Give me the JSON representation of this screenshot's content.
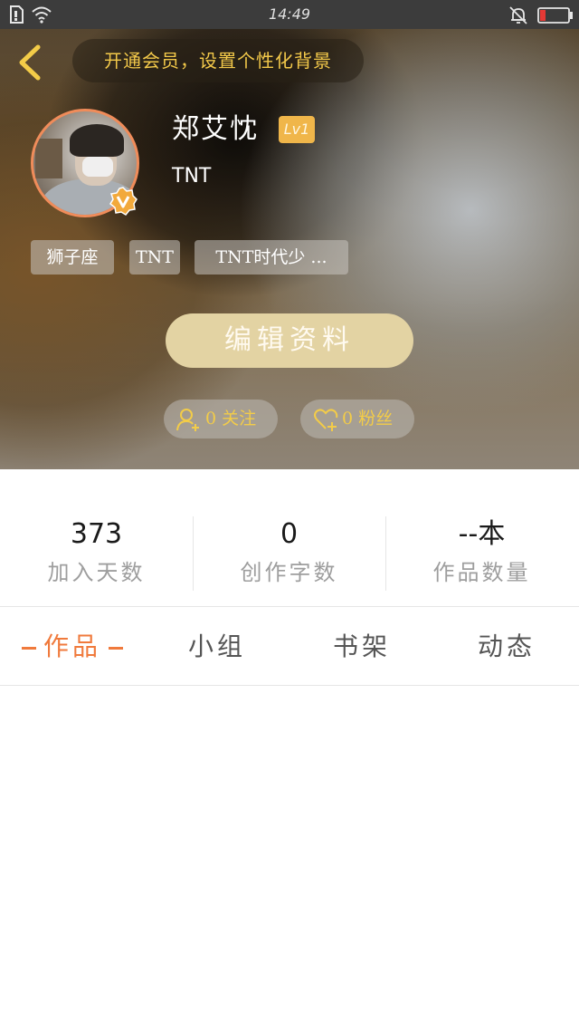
{
  "status_bar": {
    "time": "14:49",
    "icons": [
      "sim-icon",
      "wifi-icon",
      "mute-bell-icon",
      "battery-icon"
    ]
  },
  "header": {
    "vip_banner": "开通会员，设置个性化背景",
    "username": "郑艾忱",
    "level": "Lv1",
    "signature": "TNT",
    "tags": [
      "狮子座",
      "TNT",
      "TNT时代少 ..."
    ],
    "edit_button": "编辑资料",
    "following": "0 关注",
    "followers": "0 粉丝"
  },
  "stats": [
    {
      "value": "373",
      "label": "加入天数"
    },
    {
      "value": "0",
      "label": "创作字数"
    },
    {
      "value": "--本",
      "label": "作品数量"
    }
  ],
  "tabs": [
    "作品",
    "小组",
    "书架",
    "动态"
  ],
  "colors": {
    "accent": "#f07a3c",
    "gold": "#f3cc48",
    "edit_button": "#e3d3a3",
    "level_badge": "#f0b64a"
  }
}
